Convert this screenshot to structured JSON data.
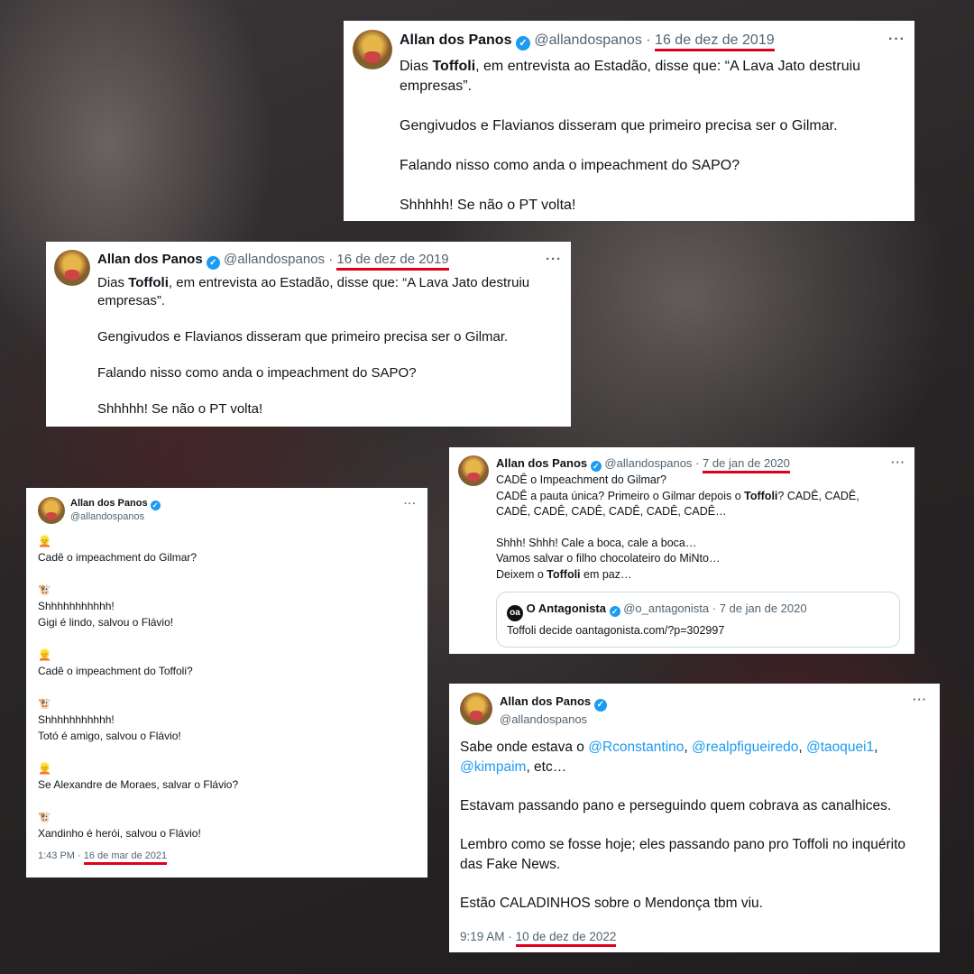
{
  "tweets": [
    {
      "name": "Allan dos Panos",
      "handle": "@allandospanos",
      "sep": "·",
      "date": "16 de dez de 2019",
      "more": "···",
      "lines": {
        "l1a": "Dias ",
        "l1b": "Toffoli",
        "l1c": ", em entrevista ao Estadão, disse que: “A Lava Jato destruiu",
        "l1d": "empresas”.",
        "l2": "Gengivudos e Flavianos disseram que primeiro precisa ser o Gilmar.",
        "l3": "Falando nisso como anda o impeachment do SAPO?",
        "l4": "Shhhhh! Se não o PT volta!"
      }
    },
    {
      "name": "Allan dos Panos",
      "handle": "@allandospanos",
      "sep": "·",
      "date": "16 de dez de 2019",
      "more": "···",
      "lines": {
        "l1a": "Dias ",
        "l1b": "Toffoli",
        "l1c": ", em entrevista ao Estadão, disse que: “A Lava Jato destruiu",
        "l1d": "empresas”.",
        "l2": "Gengivudos e Flavianos disseram que primeiro precisa ser o Gilmar.",
        "l3": "Falando nisso como anda o impeachment do SAPO?",
        "l4": "Shhhhh! Se não o PT volta!"
      }
    },
    {
      "name": "Allan dos Panos",
      "handle": "@allandospanos",
      "more": "···",
      "emoji_a": "👱",
      "emoji_b": "🐮",
      "lines": {
        "l1": "Cadê o impeachment do Gilmar?",
        "l2a": "Shhhhhhhhhhh!",
        "l2b": "Gigi é lindo, salvou o Flávio!",
        "l3": "Cadê o impeachment do Toffoli?",
        "l4a": "Shhhhhhhhhhh!",
        "l4b": "Totó é amigo, salvou o Flávio!",
        "l5": "Se Alexandre de Moraes, salvar o Flávio?",
        "l6": "Xandinho é herói, salvou o Flávio!"
      },
      "time": "1:43 PM",
      "sep": "·",
      "date": "16 de mar de 2021"
    },
    {
      "name": "Allan dos Panos",
      "handle": "@allandospanos",
      "sep": "·",
      "date": "7 de jan de 2020",
      "more": "···",
      "lines": {
        "l1": "CADÊ o Impeachment do Gilmar?",
        "l2a": "CADÊ a pauta única? Primeiro o Gilmar depois o ",
        "l2b": "Toffoli",
        "l2c": "? CADÊ, CADÊ,",
        "l3": "CADÊ, CADÊ, CADÊ, CADÊ, CADÊ, CADÊ…",
        "l4": "Shhh! Shhh! Cale a boca, cale a boca…",
        "l5": "Vamos salvar o filho chocolateiro do MiNto…",
        "l6a": "Deixem o ",
        "l6b": "Toffoli",
        "l6c": " em paz…"
      },
      "quote": {
        "logo": "oa",
        "name": "O Antagonista",
        "handle": "@o_antagonista",
        "sep": "·",
        "date": "7 de jan de 2020",
        "text": "Toffoli decide oantagonista.com/?p=302997"
      }
    },
    {
      "name": "Allan dos Panos",
      "handle": "@allandospanos",
      "more": "···",
      "lines": {
        "l1a": "Sabe onde estava o ",
        "m1": "@Rconstantino",
        "c1": ", ",
        "m2": "@realpfigueiredo",
        "c2": ", ",
        "m3": "@taoquei1",
        "c3": ",",
        "m4": "@kimpaim",
        "l1e": ", etc…",
        "l2": "Estavam passando pano e perseguindo quem cobrava as canalhices.",
        "l3a": "Lembro como se fosse hoje; eles passando pano pro Toffoli no inquérito",
        "l3b": "das Fake News.",
        "l4": "Estão CALADINHOS sobre o Mendonça tbm viu."
      },
      "time": "9:19 AM",
      "sep": "·",
      "date": "10 de dez de 2022"
    }
  ]
}
